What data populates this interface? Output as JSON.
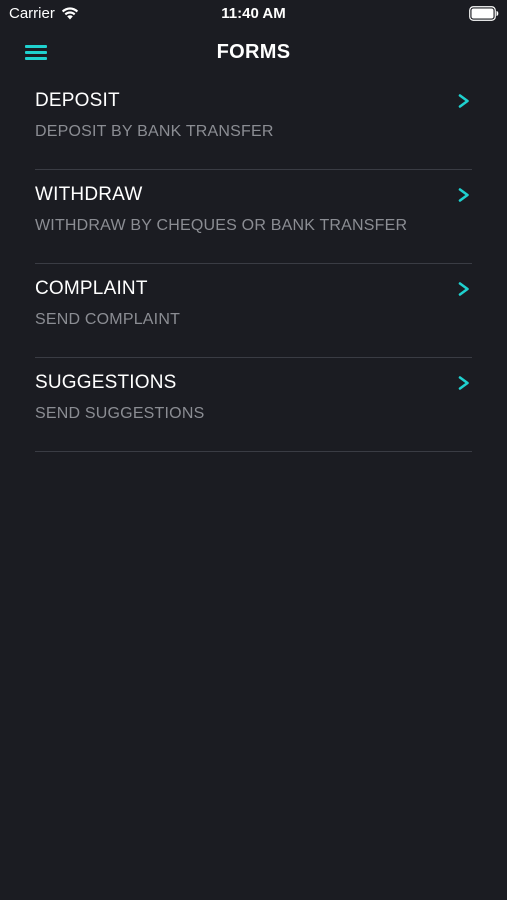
{
  "status_bar": {
    "carrier": "Carrier",
    "time": "11:40 AM"
  },
  "header": {
    "title": "FORMS"
  },
  "colors": {
    "background": "#1b1c22",
    "accent": "#1fd1cf",
    "subtitle": "#8b8d93",
    "divider": "#3a3c44"
  },
  "forms": [
    {
      "title": "DEPOSIT",
      "subtitle": "DEPOSIT BY BANK TRANSFER"
    },
    {
      "title": "WITHDRAW",
      "subtitle": "WITHDRAW BY CHEQUES OR BANK TRANSFER"
    },
    {
      "title": "COMPLAINT",
      "subtitle": "SEND COMPLAINT"
    },
    {
      "title": "SUGGESTIONS",
      "subtitle": "SEND SUGGESTIONS"
    }
  ]
}
